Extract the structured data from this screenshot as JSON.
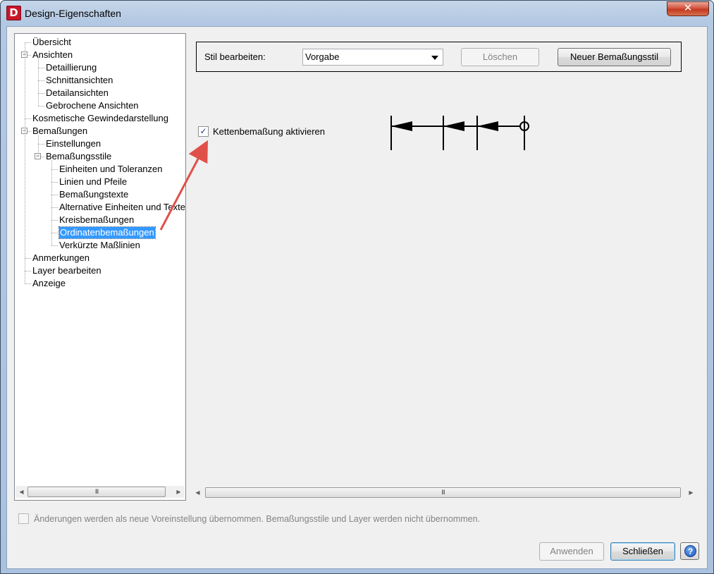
{
  "window": {
    "title": "Design-Eigenschaften",
    "app_icon_letter": "D",
    "close_glyph": "✕"
  },
  "tree": {
    "items": [
      {
        "label": "Übersicht",
        "level": 0,
        "expander": ""
      },
      {
        "label": "Ansichten",
        "level": 0,
        "expander": "−"
      },
      {
        "label": "Detaillierung",
        "level": 1,
        "expander": ""
      },
      {
        "label": "Schnittansichten",
        "level": 1,
        "expander": ""
      },
      {
        "label": "Detailansichten",
        "level": 1,
        "expander": ""
      },
      {
        "label": "Gebrochene Ansichten",
        "level": 1,
        "expander": ""
      },
      {
        "label": "Kosmetische Gewindedarstellung",
        "level": 0,
        "expander": ""
      },
      {
        "label": "Bemaßungen",
        "level": 0,
        "expander": "−"
      },
      {
        "label": "Einstellungen",
        "level": 1,
        "expander": ""
      },
      {
        "label": "Bemaßungsstile",
        "level": 1,
        "expander": "−"
      },
      {
        "label": "Einheiten und Toleranzen",
        "level": 2,
        "expander": ""
      },
      {
        "label": "Linien und Pfeile",
        "level": 2,
        "expander": ""
      },
      {
        "label": "Bemaßungstexte",
        "level": 2,
        "expander": ""
      },
      {
        "label": "Alternative Einheiten und Texte",
        "level": 2,
        "expander": ""
      },
      {
        "label": "Kreisbemaßungen",
        "level": 2,
        "expander": ""
      },
      {
        "label": "Ordinatenbemaßungen",
        "level": 2,
        "expander": "",
        "selected": true
      },
      {
        "label": "Verkürzte Maßlinien",
        "level": 2,
        "expander": ""
      },
      {
        "label": "Anmerkungen",
        "level": 0,
        "expander": ""
      },
      {
        "label": "Layer bearbeiten",
        "level": 0,
        "expander": ""
      },
      {
        "label": "Anzeige",
        "level": 0,
        "expander": ""
      }
    ],
    "scroll_grip": "III"
  },
  "style_editor": {
    "label": "Stil bearbeiten:",
    "selected_style": "Vorgabe",
    "delete_label": "Löschen",
    "new_style_label": "Neuer Bemaßungsstil"
  },
  "chain_dimension": {
    "label": "Kettenbemaßung aktivieren",
    "checked": true,
    "check_glyph": "✓"
  },
  "right_scroll_grip": "III",
  "footer": {
    "note": "Änderungen werden als neue Voreinstellung übernommen. Bemaßungsstile und Layer werden nicht übernommen.",
    "apply_label": "Anwenden",
    "close_label": "Schließen",
    "help_glyph": "?"
  },
  "colors": {
    "selection": "#3399ff",
    "annotation_arrow": "#e0504a"
  }
}
